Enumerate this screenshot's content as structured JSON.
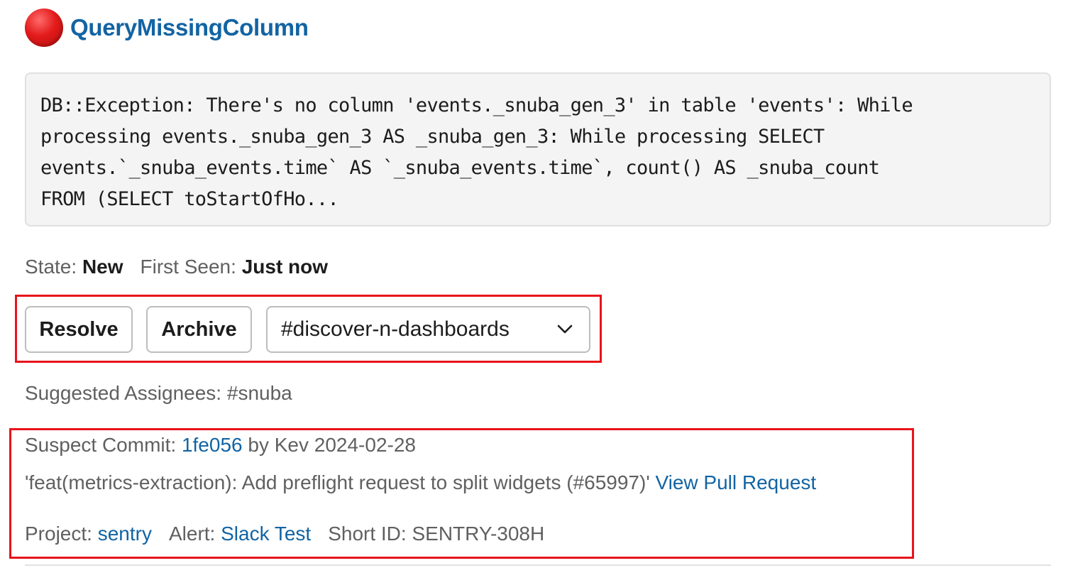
{
  "issue": {
    "title": "QueryMissingColumn",
    "status_color": "#e31b1b",
    "message": "DB::Exception: There's no column 'events._snuba_gen_3' in table 'events': While\nprocessing events._snuba_gen_3 AS _snuba_gen_3: While processing SELECT\nevents.`_snuba_events.time` AS `_snuba_events.time`, count() AS _snuba_count\nFROM (SELECT toStartOfHo..."
  },
  "status": {
    "state_label": "State:",
    "state_value": "New",
    "first_seen_label": "First Seen:",
    "first_seen_value": "Just now"
  },
  "actions": {
    "resolve_label": "Resolve",
    "archive_label": "Archive",
    "channel_select": {
      "selected": "#discover-n-dashboards",
      "icon": "chevron-down-icon"
    }
  },
  "assignees": {
    "text": "Suggested Assignees: #snuba"
  },
  "commit": {
    "label": "Suspect Commit:",
    "hash": "1fe056",
    "author_date": "by Kev 2024-02-28",
    "message": "'feat(metrics-extraction): Add preflight request to split widgets (#65997)'",
    "pr_link": "View Pull Request"
  },
  "footer": {
    "project_label": "Project:",
    "project_link": "sentry",
    "alert_label": "Alert:",
    "alert_link": "Slack Test",
    "short_id": "Short ID: SENTRY-308H"
  },
  "colors": {
    "link": "#1264a3",
    "highlight": "#e8141a",
    "code_background": "#f4f4f4"
  }
}
